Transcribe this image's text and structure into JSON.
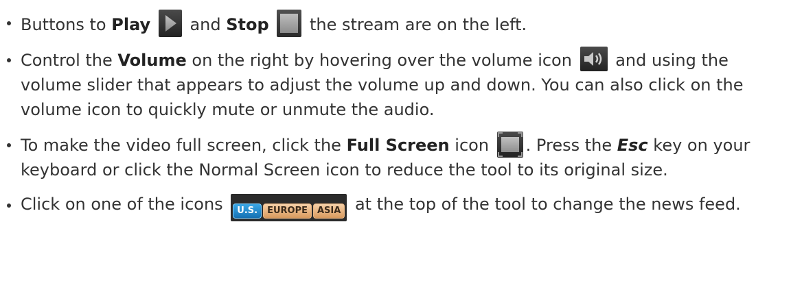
{
  "bullets": [
    {
      "t1": "Buttons to ",
      "b1": "Play",
      "t2": " and ",
      "b2": "Stop",
      "t3": " the stream are on the left."
    },
    {
      "t1": "Control the ",
      "b1": "Volume",
      "t2": " on the right by hovering over the volume icon ",
      "t3": " and using the volume slider that appears to adjust the volume up and down. You can also click on the volume icon to quickly mute or unmute the audio."
    },
    {
      "t1": "To make the video full screen, click the ",
      "b1": "Full Screen",
      "t2": " icon ",
      "t3": ". Press the ",
      "b2": "Esc",
      "t4": " key on your keyboard or click the Normal Screen icon to reduce the tool to its original size."
    },
    {
      "t1": "Click on one of the icons ",
      "t2": " at the top of the tool to change the news feed."
    }
  ],
  "feeds": [
    "U.S.",
    "EUROPE",
    "ASIA"
  ],
  "icons": {
    "play": "play-icon",
    "stop": "stop-icon",
    "volume": "volume-icon",
    "fullscreen": "fullscreen-icon"
  },
  "colors": {
    "text": "#333333",
    "active_feed": "#1f87cc",
    "inactive_feed": "#e3ad78"
  }
}
